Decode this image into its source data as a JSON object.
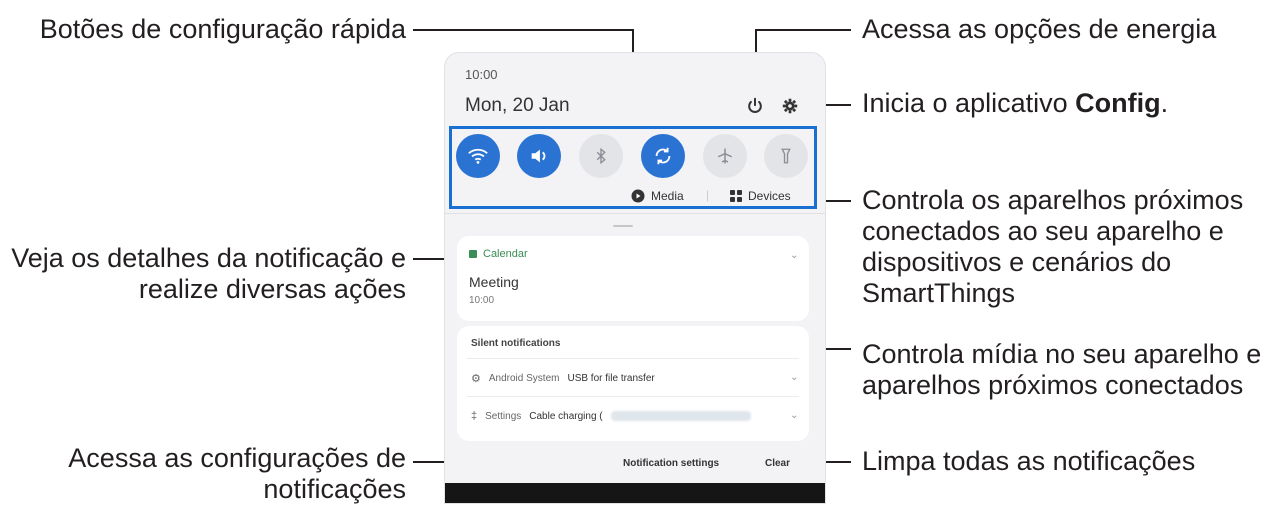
{
  "panel": {
    "status_time": "10:00",
    "date": "Mon, 20 Jan",
    "top_icons": [
      "power-icon",
      "gear-icon"
    ],
    "quick_settings": [
      {
        "icon": "wifi-icon",
        "state": "on"
      },
      {
        "icon": "sound-icon",
        "state": "on"
      },
      {
        "icon": "bluetooth-icon",
        "state": "off"
      },
      {
        "icon": "auto-rotate-icon",
        "state": "on"
      },
      {
        "icon": "airplane-icon",
        "state": "off"
      },
      {
        "icon": "flashlight-icon",
        "state": "off"
      }
    ],
    "media_label": "Media",
    "separator": "|",
    "devices_label": "Devices",
    "notification": {
      "app": "Calendar",
      "title": "Meeting",
      "time": "10:00"
    },
    "silent": {
      "header": "Silent notifications",
      "rows": [
        {
          "app": "Android System",
          "text": "USB for file transfer"
        },
        {
          "app": "Settings",
          "text": "Cable charging ("
        }
      ]
    },
    "notification_settings": "Notification settings",
    "clear": "Clear"
  },
  "callouts": {
    "quick_buttons": "Botões de configuração rápida",
    "power": "Acessa as opções de energia",
    "config_prefix": "Inicia o aplicativo ",
    "config_bold": "Config",
    "config_suffix": ".",
    "devices": [
      "Controla os aparelhos próximos",
      "conectados ao seu aparelho e",
      "dispositivos e cenários do",
      "SmartThings"
    ],
    "notification_details": [
      "Veja os detalhes da notificação e",
      "realize diversas ações"
    ],
    "media": [
      "Controla mídia no seu aparelho e",
      "aparelhos próximos conectados"
    ],
    "notification_settings": [
      "Acessa as configurações de",
      "notificações"
    ],
    "clear_all": "Limpa todas as notificações"
  },
  "colors": {
    "accent": "#2a73d2",
    "highlight_box": "#1a6fd3",
    "calendar": "#3a8e55"
  }
}
